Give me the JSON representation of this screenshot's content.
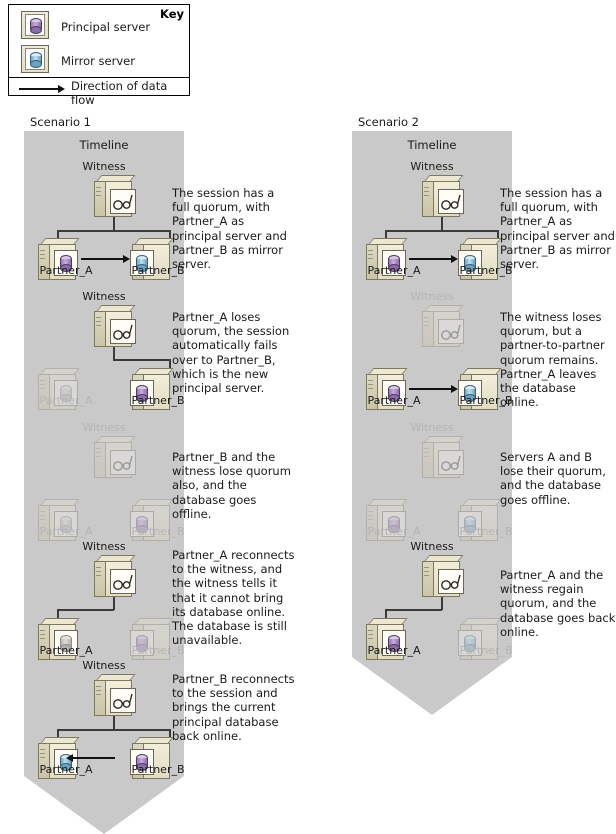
{
  "key": {
    "title": "Key",
    "items": [
      {
        "label": "Principal server",
        "icon": "principal-server-icon",
        "color": "#b28fd0"
      },
      {
        "label": "Mirror server",
        "icon": "mirror-server-icon",
        "color": "#8fc4de"
      },
      {
        "label": "Direction of data flow",
        "icon": "arrow-right-icon",
        "color": "#000000"
      }
    ]
  },
  "scenarios": [
    {
      "label": "Scenario 1",
      "timeline_title": "Timeline",
      "steps": [
        {
          "witness_label": "Witness",
          "partner_a_label": "Partner_A",
          "partner_b_label": "Partner_B",
          "description": "The session has a full quorum, with Partner_A as principal server and Partner_B as mirror server."
        },
        {
          "witness_label": "Witness",
          "partner_a_label": "Partner_A",
          "partner_b_label": "Partner_B",
          "description": "Partner_A loses quorum, the session automatically fails over to Partner_B, which is the new principal server."
        },
        {
          "witness_label": "Witness",
          "partner_a_label": "Partner_A",
          "partner_b_label": "Partner_B",
          "description": "Partner_B and the witness lose quorum also, and the database goes offline."
        },
        {
          "witness_label": "Witness",
          "partner_a_label": "Partner_A",
          "partner_b_label": "Partner_B",
          "description": "Partner_A reconnects to the witness, and the witness tells it that it cannot bring its database online. The database is still unavailable."
        },
        {
          "witness_label": "Witness",
          "partner_a_label": "Partner_A",
          "partner_b_label": "Partner_B",
          "description": "Partner_B reconnects to the session and brings the current principal database back online."
        }
      ]
    },
    {
      "label": "Scenario 2",
      "timeline_title": "Timeline",
      "steps": [
        {
          "witness_label": "Witness",
          "partner_a_label": "Partner_A",
          "partner_b_label": "Partner_B",
          "description": "The session has a full quorum, with Partner_A as principal server and Partner_B as mirror server."
        },
        {
          "witness_label": "Witness",
          "partner_a_label": "Partner_A",
          "partner_b_label": "Partner_B",
          "description": "The witness loses quorum, but a partner-to-partner quorum remains. Partner_A leaves the database online."
        },
        {
          "witness_label": "Witness",
          "partner_a_label": "Partner_A",
          "partner_b_label": "Partner_B",
          "description": "Servers A and B lose their quorum, and the database goes offline."
        },
        {
          "witness_label": "Witness",
          "partner_a_label": "Partner_A",
          "partner_b_label": "Partner_B",
          "description": "Partner_A and the witness regain quorum, and the database goes back online."
        }
      ]
    }
  ]
}
